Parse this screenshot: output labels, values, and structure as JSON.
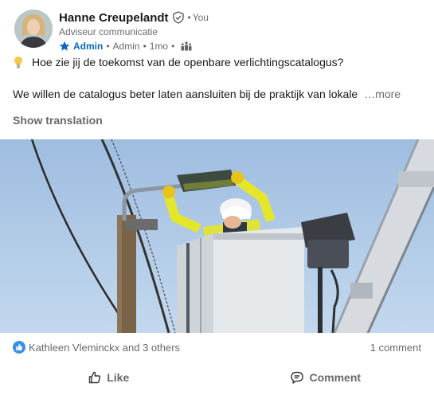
{
  "author": {
    "name": "Hanne Creupelandt",
    "you_label": "You",
    "headline": "Adviseur communicatie",
    "role": "Admin",
    "role_secondary": "Admin",
    "time": "1mo"
  },
  "post": {
    "line1": "Hoe zie jij de toekomst van de openbare verlichtingscatalogus?",
    "line2": "We willen de catalogus beter laten aansluiten bij de praktijk van lokale",
    "more_label": "…more",
    "show_translation": "Show translation"
  },
  "social": {
    "reactors": "Kathleen Vleminckx and 3 others",
    "comments": "1 comment"
  },
  "actions": {
    "like": "Like",
    "comment": "Comment"
  },
  "colors": {
    "brand_blue": "#0a66c2",
    "sky": "#a9c6e4",
    "hivis_yellow": "#e4e62a"
  }
}
